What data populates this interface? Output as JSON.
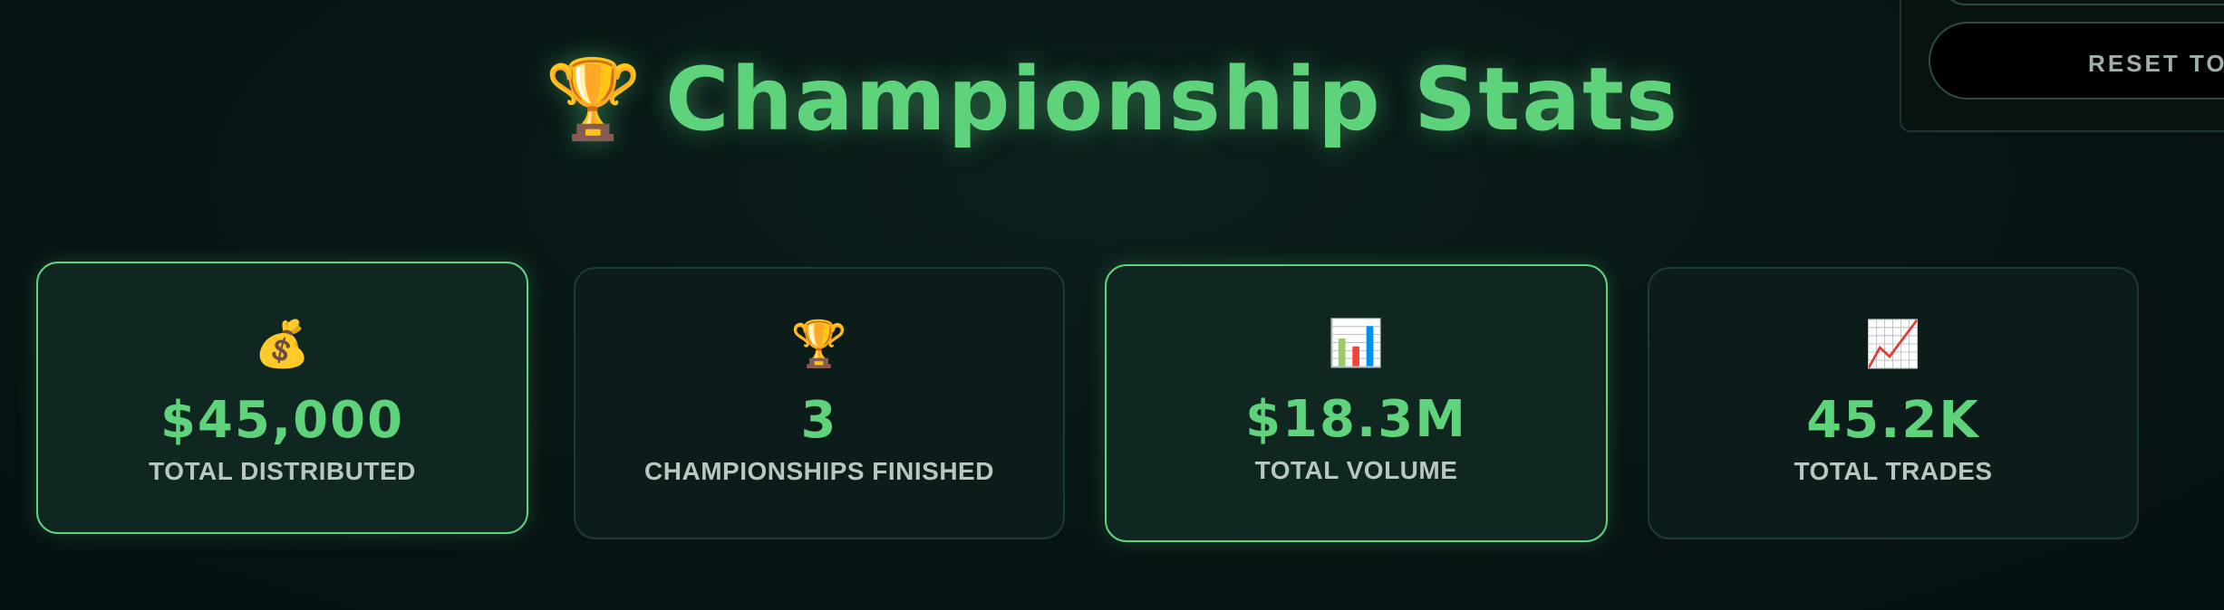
{
  "header": {
    "title": "Championship Stats",
    "title_icon": "trophy-icon"
  },
  "controls": {
    "reset_label": "RESET TO RE"
  },
  "stats": [
    {
      "icon": "money-bag-icon",
      "glyph": "💰",
      "value": "$45,000",
      "label": "TOTAL DISTRIBUTED"
    },
    {
      "icon": "trophy-icon",
      "glyph": "🏆",
      "value": "3",
      "label": "CHAMPIONSHIPS FINISHED"
    },
    {
      "icon": "bar-chart-icon",
      "glyph": "📊",
      "value": "$18.3M",
      "label": "TOTAL VOLUME"
    },
    {
      "icon": "chart-increasing-icon",
      "glyph": "📈",
      "value": "45.2K",
      "label": "TOTAL TRADES"
    }
  ],
  "colors": {
    "accent": "#5ed37c",
    "background": "#071414",
    "card_background": "#0c1c1a",
    "card_border": "#1d3a33",
    "label_text": "#b9c6c2"
  }
}
